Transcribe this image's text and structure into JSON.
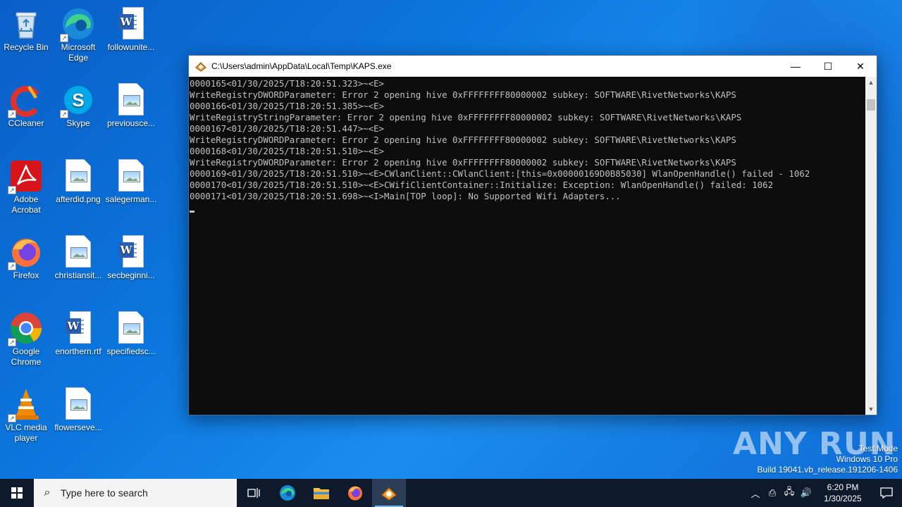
{
  "desktop": {
    "icons": [
      {
        "label": "Recycle Bin"
      },
      {
        "label": "Microsoft Edge"
      },
      {
        "label": "followunite..."
      },
      {
        "label": "CCleaner"
      },
      {
        "label": "Skype"
      },
      {
        "label": "previousce..."
      },
      {
        "label": "Adobe Acrobat"
      },
      {
        "label": "afterdid.png"
      },
      {
        "label": "salegerman..."
      },
      {
        "label": "Firefox"
      },
      {
        "label": "christiansit..."
      },
      {
        "label": "secbeginni..."
      },
      {
        "label": "Google Chrome"
      },
      {
        "label": "enorthern.rtf"
      },
      {
        "label": "specifiedsc..."
      },
      {
        "label": "VLC media player"
      },
      {
        "label": "flowerseve..."
      }
    ]
  },
  "window": {
    "title": "C:\\Users\\admin\\AppData\\Local\\Temp\\KAPS.exe",
    "minimize": "—",
    "maximize": "☐",
    "close": "✕",
    "console_lines": [
      "0000165<01/30/2025/T18:20:51.323>~<E>",
      "WriteRegistryDWORDParameter: Error 2 opening hive 0xFFFFFFFF80000002 subkey: SOFTWARE\\RivetNetworks\\KAPS",
      "0000166<01/30/2025/T18:20:51.385>~<E>",
      "WriteRegistryStringParameter: Error 2 opening hive 0xFFFFFFFF80000002 subkey: SOFTWARE\\RivetNetworks\\KAPS",
      "0000167<01/30/2025/T18:20:51.447>~<E>",
      "WriteRegistryDWORDParameter: Error 2 opening hive 0xFFFFFFFF80000002 subkey: SOFTWARE\\RivetNetworks\\KAPS",
      "0000168<01/30/2025/T18:20:51.510>~<E>",
      "WriteRegistryDWORDParameter: Error 2 opening hive 0xFFFFFFFF80000002 subkey: SOFTWARE\\RivetNetworks\\KAPS",
      "0000169<01/30/2025/T18:20:51.510>~<E>CWlanClient::CWlanClient:[this=0x00000169D0B85030] WlanOpenHandle() failed - 1062",
      "0000170<01/30/2025/T18:20:51.510>~<E>CWifiClientContainer::Initialize: Exception: WlanOpenHandle() failed: 1062",
      "0000171<01/30/2025/T18:20:51.698>~<I>Main[TOP loop]: No Supported Wifi Adapters..."
    ]
  },
  "watermark": {
    "brand": "ANY RUN",
    "line1": "Test Mode",
    "line2": "Windows 10 Pro",
    "line3": "Build 19041.vb_release.191206-1406"
  },
  "taskbar": {
    "search_placeholder": "Type here to search",
    "time": "6:20 PM",
    "date": "1/30/2025"
  },
  "colors": {
    "taskbar_bg": "#0e1a2b",
    "console_bg": "#0c0c0c",
    "console_fg": "#c0c0c0",
    "desktop_bg": "#0b76dd"
  }
}
